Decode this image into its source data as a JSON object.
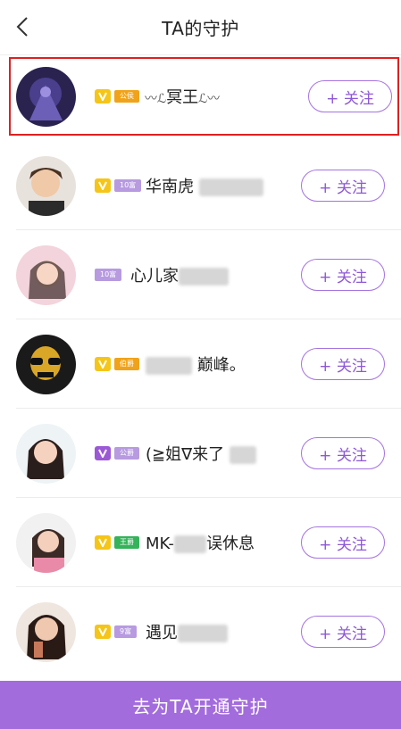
{
  "header": {
    "title": "TA的守护",
    "back_icon": "chevron-left-icon"
  },
  "accent_color": "#a36cdd",
  "guardians": [
    {
      "rank": "公侯",
      "rank_style": "gold",
      "vip": "gold",
      "name_left": "〰ℒ",
      "name": "冥王",
      "name_right": "ℒ〰",
      "follow_label": "+ 关注"
    },
    {
      "rank": "10富",
      "rank_style": "lilac",
      "vip": "gold",
      "name": "华南虎",
      "follow_label": "+ 关注"
    },
    {
      "rank": "10富",
      "rank_style": "lilac",
      "vip": "none",
      "name": "心儿家",
      "follow_label": "+ 关注"
    },
    {
      "rank": "伯爵",
      "rank_style": "gold",
      "vip": "gold",
      "name": "巅峰。",
      "follow_label": "+ 关注"
    },
    {
      "rank": "公爵",
      "rank_style": "lilac",
      "vip": "purple",
      "name": "(≧姐∇来了",
      "follow_label": "+ 关注"
    },
    {
      "rank": "王爵",
      "rank_style": "green",
      "vip": "gold",
      "name_prefix": "MK-",
      "name": "误休息",
      "follow_label": "+ 关注"
    },
    {
      "rank": "9富",
      "rank_style": "lilac",
      "vip": "gold",
      "name": "遇见",
      "follow_label": "+ 关注"
    }
  ],
  "footer": {
    "cta_label": "去为TA开通守护"
  }
}
